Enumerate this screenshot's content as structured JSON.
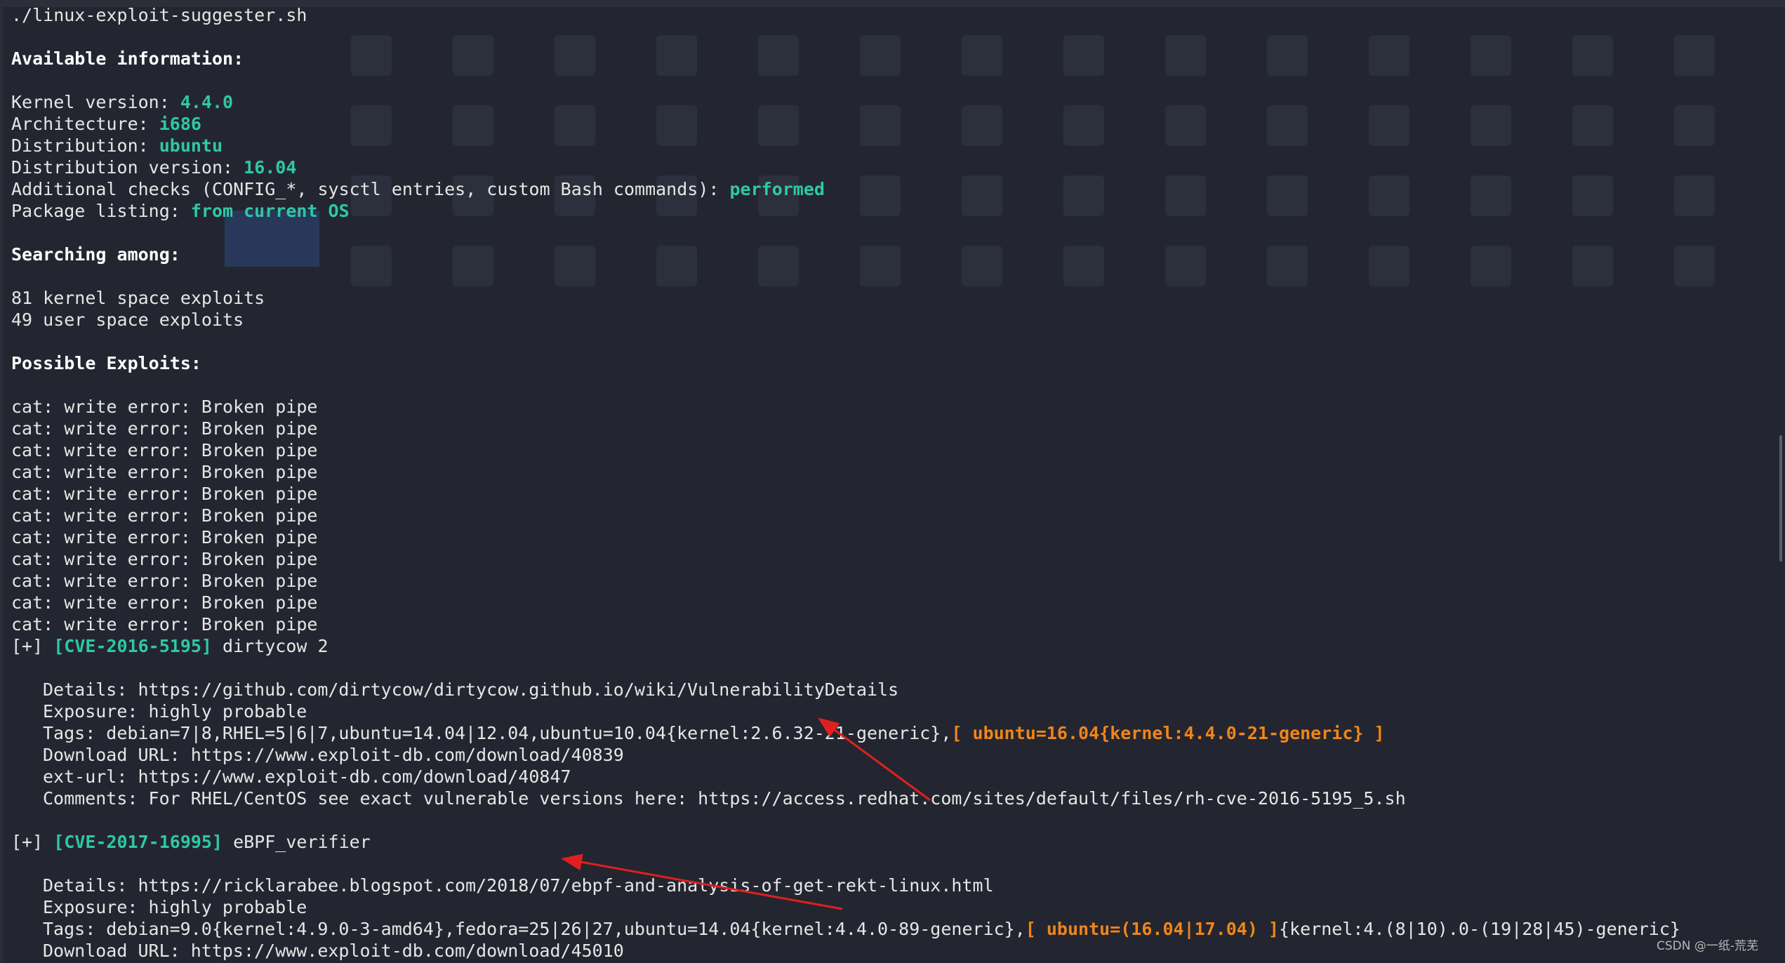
{
  "terminal": {
    "lines": [
      {
        "segs": [
          {
            "t": "./linux-exploit-suggester.sh",
            "c": "cmd"
          }
        ]
      },
      {
        "segs": []
      },
      {
        "segs": [
          {
            "t": "Available information:",
            "c": "b"
          }
        ]
      },
      {
        "segs": []
      },
      {
        "segs": [
          {
            "t": "Kernel version: ",
            "c": ""
          },
          {
            "t": "4.4.0",
            "c": "cy"
          }
        ]
      },
      {
        "segs": [
          {
            "t": "Architecture: ",
            "c": ""
          },
          {
            "t": "i686",
            "c": "cy"
          }
        ]
      },
      {
        "segs": [
          {
            "t": "Distribution: ",
            "c": ""
          },
          {
            "t": "ubuntu",
            "c": "cy"
          }
        ]
      },
      {
        "segs": [
          {
            "t": "Distribution version: ",
            "c": ""
          },
          {
            "t": "16.04",
            "c": "cy"
          }
        ]
      },
      {
        "segs": [
          {
            "t": "Additional checks (CONFIG_*, sysctl entries, custom Bash commands): ",
            "c": ""
          },
          {
            "t": "performed",
            "c": "cy"
          }
        ]
      },
      {
        "segs": [
          {
            "t": "Package listing: ",
            "c": ""
          },
          {
            "t": "from current OS",
            "c": "cy"
          }
        ]
      },
      {
        "segs": []
      },
      {
        "segs": [
          {
            "t": "Searching among:",
            "c": "b"
          }
        ]
      },
      {
        "segs": []
      },
      {
        "segs": [
          {
            "t": "81 kernel space exploits",
            "c": ""
          }
        ]
      },
      {
        "segs": [
          {
            "t": "49 user space exploits",
            "c": ""
          }
        ]
      },
      {
        "segs": []
      },
      {
        "segs": [
          {
            "t": "Possible Exploits:",
            "c": "b"
          }
        ]
      },
      {
        "segs": []
      },
      {
        "segs": [
          {
            "t": "cat: write error: Broken pipe",
            "c": ""
          }
        ]
      },
      {
        "segs": [
          {
            "t": "cat: write error: Broken pipe",
            "c": ""
          }
        ]
      },
      {
        "segs": [
          {
            "t": "cat: write error: Broken pipe",
            "c": ""
          }
        ]
      },
      {
        "segs": [
          {
            "t": "cat: write error: Broken pipe",
            "c": ""
          }
        ]
      },
      {
        "segs": [
          {
            "t": "cat: write error: Broken pipe",
            "c": ""
          }
        ]
      },
      {
        "segs": [
          {
            "t": "cat: write error: Broken pipe",
            "c": ""
          }
        ]
      },
      {
        "segs": [
          {
            "t": "cat: write error: Broken pipe",
            "c": ""
          }
        ]
      },
      {
        "segs": [
          {
            "t": "cat: write error: Broken pipe",
            "c": ""
          }
        ]
      },
      {
        "segs": [
          {
            "t": "cat: write error: Broken pipe",
            "c": ""
          }
        ]
      },
      {
        "segs": [
          {
            "t": "cat: write error: Broken pipe",
            "c": ""
          }
        ]
      },
      {
        "segs": [
          {
            "t": "cat: write error: Broken pipe",
            "c": ""
          }
        ]
      },
      {
        "segs": [
          {
            "t": "[+] ",
            "c": ""
          },
          {
            "t": "[CVE-2016-5195]",
            "c": "cy"
          },
          {
            "t": " dirtycow 2",
            "c": ""
          }
        ]
      },
      {
        "segs": []
      },
      {
        "ind": true,
        "segs": [
          {
            "t": "Details: https://github.com/dirtycow/dirtycow.github.io/wiki/VulnerabilityDetails",
            "c": ""
          }
        ]
      },
      {
        "ind": true,
        "segs": [
          {
            "t": "Exposure: highly probable",
            "c": ""
          }
        ]
      },
      {
        "ind": true,
        "segs": [
          {
            "t": "Tags: debian=7|8,RHEL=5|6|7,ubuntu=14.04|12.04,ubuntu=10.04{kernel:2.6.32-21-generic},",
            "c": ""
          },
          {
            "t": "[ ubuntu=16.04{kernel:4.4.0-21-generic} ]",
            "c": "org"
          }
        ]
      },
      {
        "ind": true,
        "segs": [
          {
            "t": "Download URL: https://www.exploit-db.com/download/40839",
            "c": ""
          }
        ]
      },
      {
        "ind": true,
        "segs": [
          {
            "t": "ext-url: https://www.exploit-db.com/download/40847",
            "c": ""
          }
        ]
      },
      {
        "ind": true,
        "segs": [
          {
            "t": "Comments: For RHEL/CentOS see exact vulnerable versions here: https://access.redhat.com/sites/default/files/rh-cve-2016-5195_5.sh",
            "c": ""
          }
        ]
      },
      {
        "segs": []
      },
      {
        "segs": [
          {
            "t": "[+] ",
            "c": ""
          },
          {
            "t": "[CVE-2017-16995]",
            "c": "cy"
          },
          {
            "t": " eBPF_verifier",
            "c": ""
          }
        ]
      },
      {
        "segs": []
      },
      {
        "ind": true,
        "segs": [
          {
            "t": "Details: https://ricklarabee.blogspot.com/2018/07/ebpf-and-analysis-of-get-rekt-linux.html",
            "c": ""
          }
        ]
      },
      {
        "ind": true,
        "segs": [
          {
            "t": "Exposure: highly probable",
            "c": ""
          }
        ]
      },
      {
        "ind": true,
        "segs": [
          {
            "t": "Tags: debian=9.0{kernel:4.9.0-3-amd64},fedora=25|26|27,ubuntu=14.04{kernel:4.4.0-89-generic},",
            "c": ""
          },
          {
            "t": "[ ubuntu=(16.04|17.04) ]",
            "c": "org"
          },
          {
            "t": "{kernel:4.(8|10).0-(19|28|45)-generic}",
            "c": ""
          }
        ]
      },
      {
        "ind": true,
        "segs": [
          {
            "t": "Download URL: https://www.exploit-db.com/download/45010",
            "c": ""
          }
        ]
      }
    ]
  },
  "watermark": "CSDN @一纸-荒芜",
  "colors": {
    "accent_cyan": "#2ec8a6",
    "highlight_orange": "#f0851a",
    "arrow_red": "#e02020",
    "background": "#232630"
  }
}
